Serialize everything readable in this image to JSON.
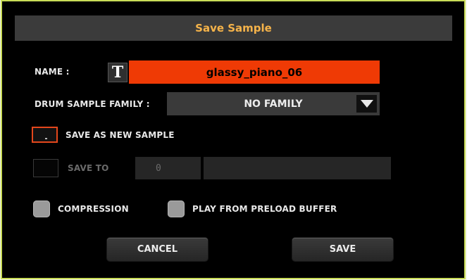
{
  "dialog": {
    "title": "Save Sample",
    "name_label": "NAME :",
    "name_value": "glassy_piano_06",
    "family_label": "DRUM SAMPLE FAMILY :",
    "family_value": "NO FAMILY",
    "save_as_new_label": "SAVE AS NEW SAMPLE",
    "save_to_label": "SAVE TO",
    "save_to_number": "0",
    "compression_label": "COMPRESSION",
    "preload_label": "PLAY FROM PRELOAD BUFFER",
    "cancel_label": "CANCEL",
    "save_label": "SAVE"
  },
  "icons": {
    "text_edit": "T"
  },
  "colors": {
    "accent_orange": "#ef3a05",
    "title_text": "#f5b34a",
    "frame_border": "#c9dc57"
  }
}
